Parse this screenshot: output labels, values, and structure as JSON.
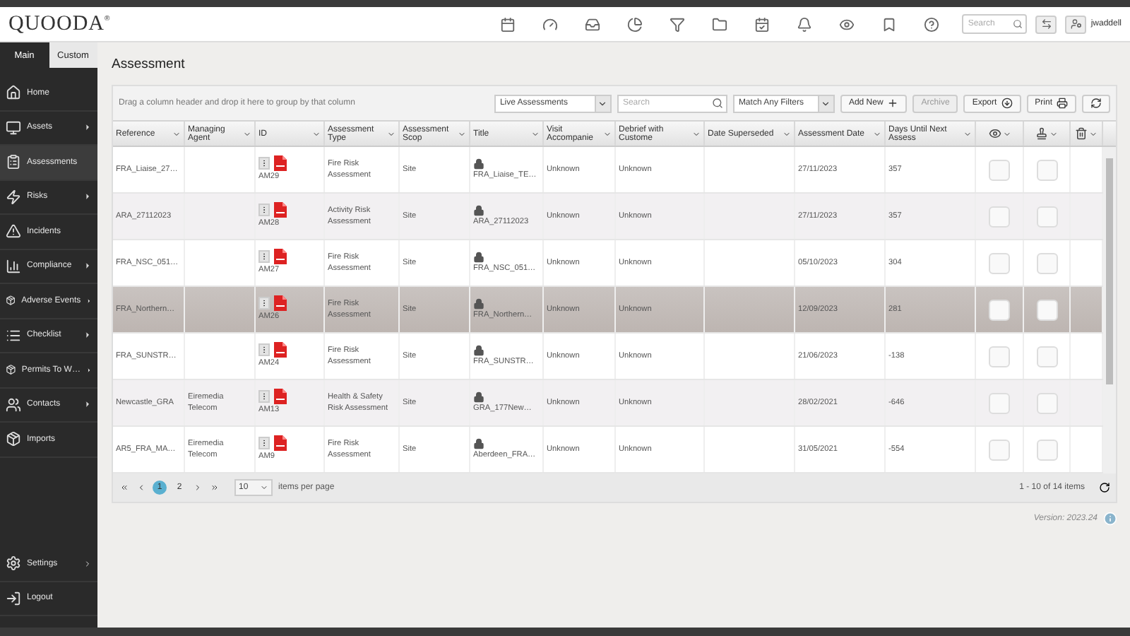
{
  "header": {
    "logo": "QUOODA",
    "logo_mark": "®",
    "search": {
      "placeholder": "Search"
    },
    "user": "jwaddell"
  },
  "sidebar": {
    "tabs": [
      {
        "label": "Main",
        "selected": true
      },
      {
        "label": "Custom",
        "selected": false
      }
    ],
    "items": [
      {
        "label": "Home",
        "submenu": false,
        "selected": false
      },
      {
        "label": "Assets",
        "submenu": true,
        "selected": false
      },
      {
        "label": "Assessments",
        "submenu": false,
        "selected": true
      },
      {
        "label": "Risks",
        "submenu": true,
        "selected": false
      },
      {
        "label": "Incidents",
        "submenu": false,
        "selected": false
      },
      {
        "label": "Compliance",
        "submenu": true,
        "selected": false
      },
      {
        "label": "Adverse Events",
        "submenu": true,
        "selected": false
      },
      {
        "label": "Checklist",
        "submenu": true,
        "selected": false
      },
      {
        "label": "Permits To W…",
        "submenu": true,
        "selected": false
      },
      {
        "label": "Contacts",
        "submenu": true,
        "selected": false
      },
      {
        "label": "Imports",
        "submenu": false,
        "selected": false
      }
    ],
    "footer_items": [
      {
        "label": "Settings",
        "submenu": true
      },
      {
        "label": "Logout",
        "submenu": false
      }
    ]
  },
  "page_title": "Assessment",
  "grid": {
    "group_hint": "Drag a column header and drop it here to group by that column",
    "view_select": "Live Assessments",
    "search": {
      "placeholder": "Search"
    },
    "filter_select": "Match Any Filters",
    "buttons": [
      {
        "label": "Add New",
        "kind": "add",
        "disabled": false
      },
      {
        "label": "Archive",
        "kind": "plain",
        "disabled": true
      },
      {
        "label": "Export",
        "kind": "export",
        "disabled": false
      },
      {
        "label": "Print",
        "kind": "print",
        "disabled": false
      },
      {
        "kind": "refresh",
        "disabled": false
      }
    ],
    "columns": [
      {
        "kind": "text",
        "label": "Reference"
      },
      {
        "kind": "text",
        "label": "Managing Agent"
      },
      {
        "kind": "text",
        "label": "ID"
      },
      {
        "kind": "text",
        "label": "Assessment Type"
      },
      {
        "kind": "text",
        "label": "Assessment Scop"
      },
      {
        "kind": "text",
        "label": "Title"
      },
      {
        "kind": "text",
        "label": "Visit Accompanie"
      },
      {
        "kind": "text",
        "label": "Debrief with Custome"
      },
      {
        "kind": "text",
        "label": "Date Superseded"
      },
      {
        "kind": "text",
        "label": "Assessment Date"
      },
      {
        "kind": "text",
        "label": "Days Until Next Assess"
      },
      {
        "kind": "eye"
      },
      {
        "kind": "stamp"
      },
      {
        "kind": "trash"
      }
    ],
    "rows": [
      {
        "reference": "FRA_Liaise_27…",
        "id": "AM29",
        "type": "Fire Risk Assessment",
        "scope": "Site",
        "title": "FRA_Liaise_TE…",
        "visit": "Unknown",
        "debrief": "Unknown",
        "assessment_date": "27/11/2023",
        "days": "357",
        "viewed": false,
        "stamped": false,
        "selected": false
      },
      {
        "reference": "ARA_27112023",
        "id": "AM28",
        "type": "Activity Risk Assessment",
        "scope": "Site",
        "title": "ARA_27112023",
        "visit": "Unknown",
        "debrief": "Unknown",
        "assessment_date": "27/11/2023",
        "days": "357",
        "viewed": false,
        "stamped": false,
        "selected": false
      },
      {
        "reference": "FRA_NSC_051…",
        "id": "AM27",
        "type": "Fire Risk Assessment",
        "scope": "Site",
        "title": "FRA_NSC_051…",
        "visit": "Unknown",
        "debrief": "Unknown",
        "assessment_date": "05/10/2023",
        "days": "304",
        "viewed": false,
        "stamped": false,
        "selected": false
      },
      {
        "reference": "FRA_Northern…",
        "id": "AM26",
        "type": "Fire Risk Assessment",
        "scope": "Site",
        "title": "FRA_Northern…",
        "visit": "Unknown",
        "debrief": "Unknown",
        "assessment_date": "12/09/2023",
        "days": "281",
        "viewed": false,
        "stamped": false,
        "selected": true
      },
      {
        "reference": "FRA_SUNSTR…",
        "id": "AM24",
        "type": "Fire Risk Assessment",
        "scope": "Site",
        "title": "FRA_SUNSTR…",
        "visit": "Unknown",
        "debrief": "Unknown",
        "assessment_date": "21/06/2023",
        "days": "-138",
        "viewed": false,
        "stamped": false,
        "selected": false
      },
      {
        "reference": "Newcastle_GRA",
        "managing_agent": "Eiremedia Telecom",
        "id": "AM13",
        "type": "Health & Safety Risk Assessment",
        "scope": "Site",
        "title": "GRA_177New…",
        "visit": "Unknown",
        "debrief": "Unknown",
        "assessment_date": "28/02/2021",
        "days": "-646",
        "viewed": false,
        "stamped": false,
        "selected": false
      },
      {
        "reference": "AR5_FRA_MA…",
        "managing_agent": "Eiremedia Telecom",
        "id": "AM9",
        "type": "Fire Risk Assessment",
        "scope": "Site",
        "title": "Aberdeen_FRA…",
        "visit": "Unknown",
        "debrief": "Unknown",
        "assessment_date": "31/05/2021",
        "days": "-554",
        "viewed": false,
        "stamped": false,
        "selected": false
      }
    ],
    "pager": {
      "pages": [
        {
          "label": "1",
          "selected": true
        },
        {
          "label": "2",
          "selected": false
        }
      ],
      "page_size": "10",
      "page_size_label": "items per page",
      "summary": "1 - 10 of 14 items"
    }
  },
  "version": "Version: 2023.24"
}
